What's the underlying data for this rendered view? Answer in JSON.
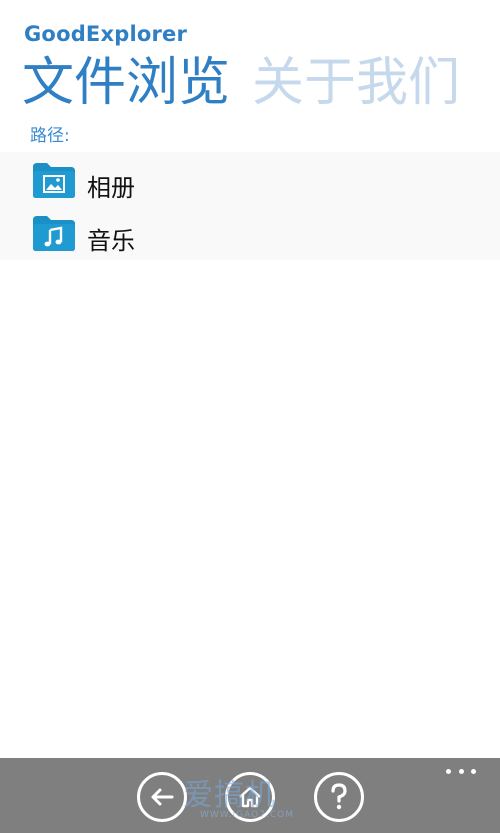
{
  "app": {
    "title": "GoodExplorer"
  },
  "pivot": {
    "tabs": [
      {
        "label": "文件浏览",
        "active": true
      },
      {
        "label": "关于我们",
        "active": false
      }
    ]
  },
  "path": {
    "label": "路径:"
  },
  "files": [
    {
      "name": "相册",
      "icon": "pictures-folder-icon"
    },
    {
      "name": "音乐",
      "icon": "music-folder-icon"
    }
  ],
  "app_bar": {
    "buttons": [
      {
        "icon": "back-arrow-icon"
      },
      {
        "icon": "home-icon"
      },
      {
        "icon": "help-icon"
      }
    ],
    "more_icon": "ellipsis-icon"
  },
  "watermark": {
    "text": "爱搞机",
    "url": "WWW.IGAO7.COM"
  },
  "colors": {
    "accent": "#2f7fc4",
    "inactive_tab": "#c6d9ec",
    "folder": "#1b90c6",
    "app_bar": "#7f7f7f"
  }
}
